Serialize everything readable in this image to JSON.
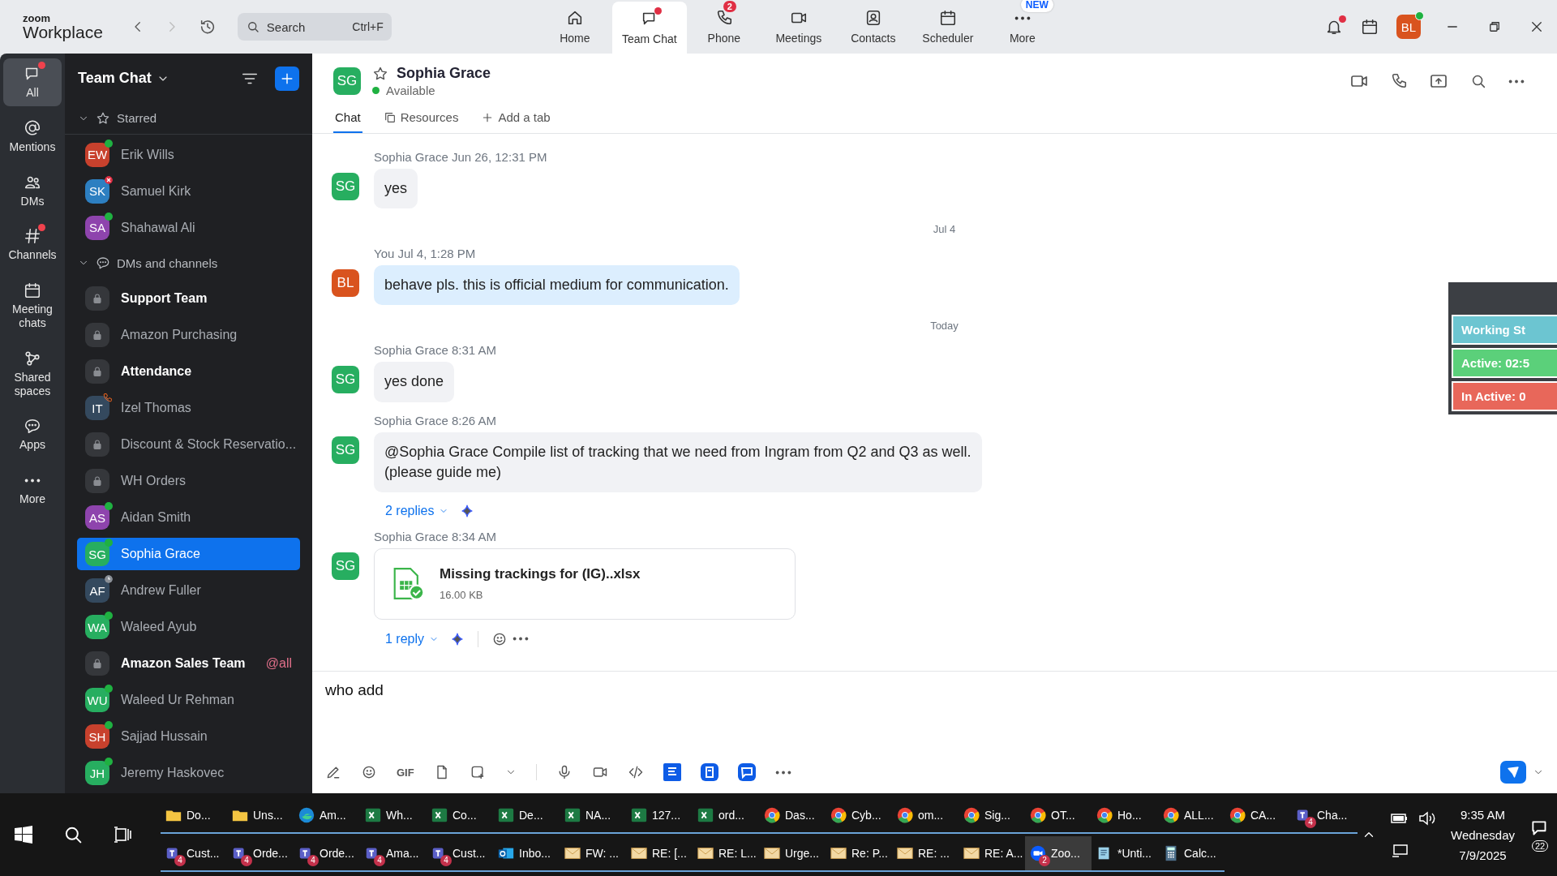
{
  "app": {
    "logo_top": "zoom",
    "logo_bottom": "Workplace"
  },
  "search": {
    "placeholder": "Search",
    "shortcut": "Ctrl+F"
  },
  "nav": [
    {
      "label": "Home",
      "selected": false
    },
    {
      "label": "Team Chat",
      "selected": true,
      "dot": true
    },
    {
      "label": "Phone",
      "selected": false,
      "badge": "2"
    },
    {
      "label": "Meetings",
      "selected": false
    },
    {
      "label": "Contacts",
      "selected": false
    },
    {
      "label": "Scheduler",
      "selected": false
    },
    {
      "label": "More",
      "selected": false,
      "tag": "NEW"
    }
  ],
  "notifications": {
    "dot": true
  },
  "user": {
    "initials": "BL",
    "color": "#d9531e",
    "online": true
  },
  "rail": [
    {
      "label": "All",
      "selected": true,
      "dot": true
    },
    {
      "label": "Mentions",
      "selected": false
    },
    {
      "label": "DMs",
      "selected": false
    },
    {
      "label": "Channels",
      "selected": false,
      "dot": true
    },
    {
      "label": "Meeting chats",
      "selected": false
    },
    {
      "label": "Shared spaces",
      "selected": false
    },
    {
      "label": "Apps",
      "selected": false
    },
    {
      "label": "More",
      "selected": false
    }
  ],
  "sidebar": {
    "title": "Team Chat",
    "sections": [
      {
        "title": "Starred",
        "expanded": true,
        "items": [
          {
            "kind": "person",
            "name": "Erik Wills",
            "initials": "EW",
            "color": "#c8412d",
            "presence": {
              "kind": "online"
            },
            "unread": false,
            "selected": false
          },
          {
            "kind": "person",
            "name": "Samuel Kirk",
            "initials": "SK",
            "color": "#2d7fc1",
            "presence": {
              "kind": "busy"
            },
            "unread": false,
            "selected": false
          },
          {
            "kind": "person",
            "name": "Shahawal Ali",
            "initials": "SA",
            "color": "#8e44ad",
            "presence": {
              "kind": "online"
            },
            "unread": false,
            "selected": false
          }
        ]
      },
      {
        "title": "DMs and channels",
        "expanded": true,
        "items": [
          {
            "kind": "channel",
            "name": "Support Team",
            "unread": true,
            "selected": false
          },
          {
            "kind": "channel",
            "name": "Amazon Purchasing",
            "unread": false,
            "selected": false
          },
          {
            "kind": "channel",
            "name": "Attendance",
            "unread": true,
            "selected": false
          },
          {
            "kind": "person",
            "name": "Izel Thomas",
            "initials": "IT",
            "color": "#34495e",
            "presence": {
              "kind": "call"
            },
            "unread": false,
            "selected": false
          },
          {
            "kind": "channel",
            "name": "Discount & Stock Reservatio...",
            "unread": false,
            "selected": false
          },
          {
            "kind": "channel",
            "name": "WH Orders",
            "unread": false,
            "selected": false
          },
          {
            "kind": "person",
            "name": "Aidan Smith",
            "initials": "AS",
            "color": "#8e44ad",
            "presence": {
              "kind": "online"
            },
            "unread": false,
            "selected": false
          },
          {
            "kind": "person",
            "name": "Sophia Grace",
            "initials": "SG",
            "color": "#27ae60",
            "presence": {
              "kind": "online"
            },
            "unread": false,
            "selected": true
          },
          {
            "kind": "person",
            "name": "Andrew Fuller",
            "initials": "AF",
            "color": "#34495e",
            "presence": {
              "kind": "away"
            },
            "unread": false,
            "selected": false
          },
          {
            "kind": "person",
            "name": "Waleed Ayub",
            "initials": "WA",
            "color": "#27ae60",
            "presence": {
              "kind": "online"
            },
            "unread": false,
            "selected": false
          },
          {
            "kind": "channel",
            "name": "Amazon Sales Team",
            "unread": true,
            "selected": false,
            "mention": "@all"
          },
          {
            "kind": "person",
            "name": "Waleed Ur Rehman",
            "initials": "WU",
            "color": "#27ae60",
            "presence": {
              "kind": "online"
            },
            "unread": false,
            "selected": false
          },
          {
            "kind": "person",
            "name": "Sajjad Hussain",
            "initials": "SH",
            "color": "#c8412d",
            "presence": {
              "kind": "online"
            },
            "unread": false,
            "selected": false
          },
          {
            "kind": "person",
            "name": "Jeremy Haskovec",
            "initials": "JH",
            "color": "#27ae60",
            "presence": {
              "kind": "online"
            },
            "unread": false,
            "selected": false
          }
        ]
      }
    ]
  },
  "chat": {
    "header": {
      "initials": "SG",
      "color": "#27ae60",
      "name": "Sophia Grace",
      "status": "Available",
      "starred": false
    },
    "tabs": [
      {
        "label": "Chat",
        "selected": true
      },
      {
        "label": "Resources",
        "selected": false
      },
      {
        "label": "Add a tab",
        "selected": false
      }
    ],
    "messages": [
      {
        "kind": "message",
        "sender": "Sophia Grace",
        "time": "Jun 26, 12:31 PM",
        "initials": "SG",
        "color": "#27ae60",
        "mine": false,
        "text": "yes"
      },
      {
        "kind": "date",
        "text": "Jul 4"
      },
      {
        "kind": "message",
        "sender": "You",
        "time": "Jul 4, 1:28 PM",
        "initials": "BL",
        "color": "#d9531e",
        "mine": true,
        "text": "behave pls. this is official medium for communication."
      },
      {
        "kind": "date",
        "text": "Today"
      },
      {
        "kind": "message",
        "sender": "Sophia Grace",
        "time": "8:31 AM",
        "initials": "SG",
        "color": "#27ae60",
        "mine": false,
        "text": "yes done"
      },
      {
        "kind": "message",
        "sender": "Sophia Grace",
        "time": "8:26 AM",
        "initials": "SG",
        "color": "#27ae60",
        "mine": false,
        "text": "@Sophia Grace Compile list of tracking that we need from Ingram from Q2 and Q3 as well.\n(please guide me)",
        "replies": "2 replies"
      },
      {
        "kind": "file",
        "sender": "Sophia Grace",
        "time": "8:34 AM",
        "initials": "SG",
        "color": "#27ae60",
        "mine": false,
        "file_name": "Missing trackings for (IG)..xlsx",
        "file_size": "16.00 KB",
        "replies": "1 reply"
      }
    ],
    "composer": {
      "value": "who add",
      "gif_label": "GIF"
    }
  },
  "widget": [
    {
      "text": "Working St",
      "color": "#6cc5d1"
    },
    {
      "text": "Active: 02:5",
      "color": "#5bd07a"
    },
    {
      "text": "In Active: 0",
      "color": "#e8675a"
    }
  ],
  "taskbar": {
    "rows": [
      [
        {
          "kind": "folder",
          "label": "Do...",
          "selected": false
        },
        {
          "kind": "folder",
          "label": "Uns...",
          "selected": false
        },
        {
          "kind": "edge",
          "label": "Am...",
          "selected": false
        },
        {
          "kind": "excel",
          "label": "Wh...",
          "selected": false
        },
        {
          "kind": "excel",
          "label": "Co...",
          "selected": false
        },
        {
          "kind": "excel",
          "label": "De...",
          "selected": false
        },
        {
          "kind": "excel",
          "label": "NA...",
          "selected": false
        },
        {
          "kind": "excel",
          "label": "127...",
          "selected": false
        },
        {
          "kind": "excel",
          "label": "ord...",
          "selected": false
        },
        {
          "kind": "chrome",
          "label": "Das...",
          "selected": false
        },
        {
          "kind": "chrome",
          "label": "Cyb...",
          "selected": false
        },
        {
          "kind": "chrome",
          "label": "om...",
          "selected": false
        },
        {
          "kind": "chrome",
          "label": "Sig...",
          "selected": false
        },
        {
          "kind": "chrome",
          "label": "OT...",
          "selected": false
        },
        {
          "kind": "chrome",
          "label": "Ho...",
          "selected": false
        },
        {
          "kind": "chrome",
          "label": "ALL...",
          "selected": false
        },
        {
          "kind": "chrome",
          "label": "CA...",
          "selected": false
        },
        {
          "kind": "teams",
          "label": "Cha...",
          "badge": "4",
          "selected": false
        }
      ],
      [
        {
          "kind": "teams",
          "label": "Cust...",
          "badge": "4",
          "selected": false
        },
        {
          "kind": "teams",
          "label": "Orde...",
          "badge": "4",
          "selected": false
        },
        {
          "kind": "teams",
          "label": "Orde...",
          "badge": "4",
          "selected": false
        },
        {
          "kind": "teams",
          "label": "Ama...",
          "badge": "4",
          "selected": false
        },
        {
          "kind": "teams",
          "label": "Cust...",
          "badge": "4",
          "selected": false
        },
        {
          "kind": "outlook",
          "label": "Inbo...",
          "selected": false
        },
        {
          "kind": "mail",
          "label": "FW: ...",
          "selected": false
        },
        {
          "kind": "mail",
          "label": "RE: [...",
          "selected": false
        },
        {
          "kind": "mail",
          "label": "RE: L...",
          "selected": false
        },
        {
          "kind": "mail",
          "label": "Urge...",
          "selected": false
        },
        {
          "kind": "mail",
          "label": "Re: P...",
          "selected": false
        },
        {
          "kind": "mail",
          "label": "RE: ...",
          "selected": false
        },
        {
          "kind": "mail",
          "label": "RE: A...",
          "selected": false
        },
        {
          "kind": "zoom",
          "label": "Zoo...",
          "badge": "2",
          "selected": true
        },
        {
          "kind": "notepad",
          "label": "*Unti...",
          "selected": false
        },
        {
          "kind": "calculator",
          "label": "Calc...",
          "selected": false
        }
      ]
    ],
    "clock": {
      "time": "9:35 AM",
      "day": "Wednesday",
      "date": "7/9/2025"
    },
    "notifications": "22"
  }
}
